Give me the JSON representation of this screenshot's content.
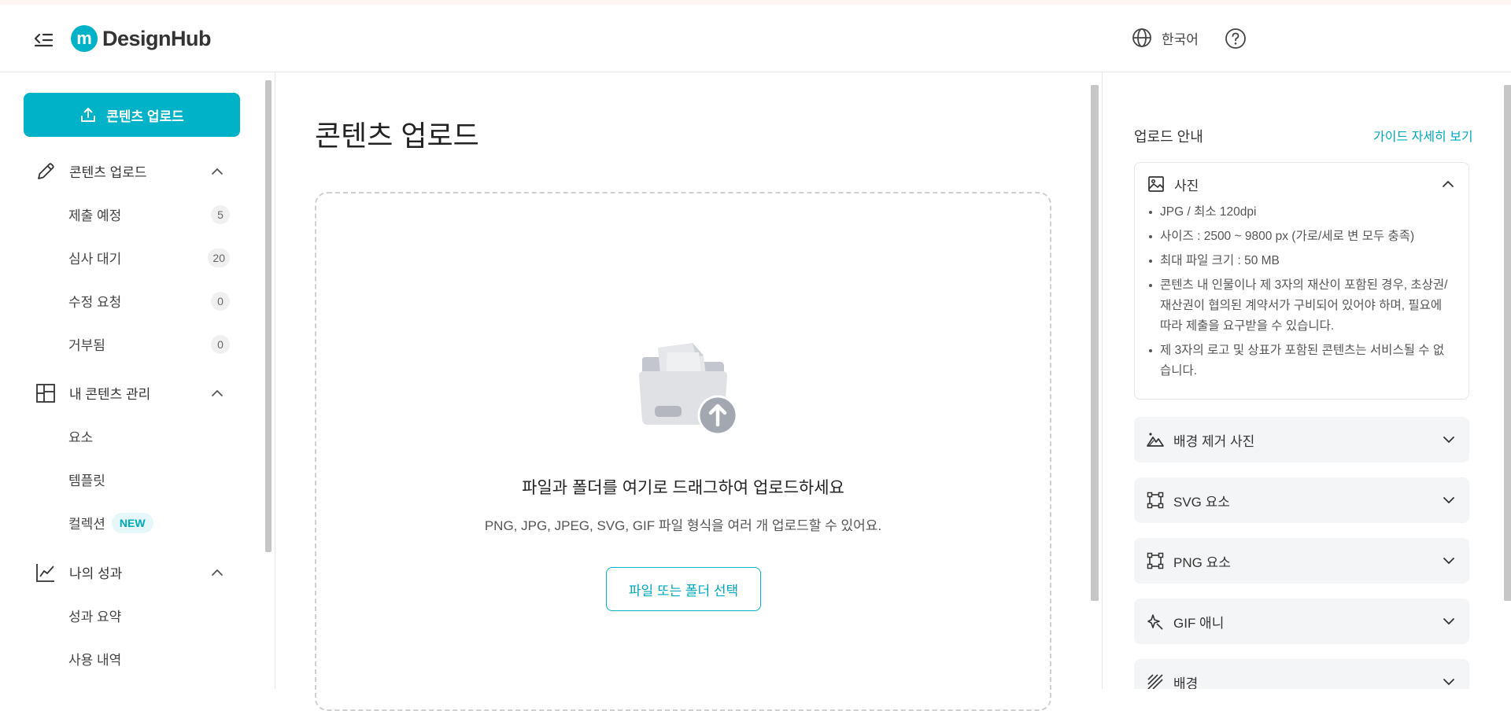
{
  "header": {
    "brand": "DesignHub",
    "language": "한국어"
  },
  "sidebar": {
    "upload_button": "콘텐츠 업로드",
    "groups": [
      {
        "label": "콘텐츠 업로드",
        "icon": "pencil-icon",
        "items": [
          {
            "label": "제출 예정",
            "count": "5"
          },
          {
            "label": "심사 대기",
            "count": "20"
          },
          {
            "label": "수정 요청",
            "count": "0"
          },
          {
            "label": "거부됨",
            "count": "0"
          }
        ]
      },
      {
        "label": "내 콘텐츠 관리",
        "icon": "layout-grid-icon",
        "items": [
          {
            "label": "요소"
          },
          {
            "label": "템플릿"
          },
          {
            "label": "컬렉션",
            "badge": "NEW"
          }
        ]
      },
      {
        "label": "나의 성과",
        "icon": "line-chart-icon",
        "items": [
          {
            "label": "성과 요약"
          },
          {
            "label": "사용 내역"
          }
        ]
      }
    ]
  },
  "main": {
    "title": "콘텐츠 업로드",
    "dropzone": {
      "title": "파일과 폴더를 여기로 드래그하여 업로드하세요",
      "subtitle": "PNG, JPG, JPEG, SVG, GIF 파일 형식을 여러 개 업로드할 수 있어요.",
      "button": "파일 또는 폴더 선택"
    }
  },
  "guide": {
    "title": "업로드 안내",
    "link": "가이드 자세히 보기",
    "sections": [
      {
        "label": "사진",
        "icon": "image-icon",
        "expanded": true,
        "bullets": [
          "JPG / 최소 120dpi",
          "사이즈 : 2500 ~ 9800 px (가로/세로 변 모두 충족)",
          "최대 파일 크기 : 50 MB",
          "콘텐츠 내 인물이나 제 3자의 재산이 포함된 경우, 초상권/재산권이 협의된 계약서가 구비되어 있어야 하며, 필요에 따라 제출을 요구받을 수 있습니다.",
          "제 3자의 로고 및 상표가 포함된 콘텐츠는 서비스될 수 없습니다."
        ]
      },
      {
        "label": "배경 제거 사진",
        "icon": "mountain-icon",
        "expanded": false
      },
      {
        "label": "SVG 요소",
        "icon": "vector-square-icon",
        "expanded": false
      },
      {
        "label": "PNG 요소",
        "icon": "vector-square-icon",
        "expanded": false
      },
      {
        "label": "GIF 애니",
        "icon": "sparkle-icon",
        "expanded": false
      },
      {
        "label": "배경",
        "icon": "hatch-pattern-icon",
        "expanded": false
      }
    ]
  },
  "colors": {
    "accent": "#00b2c8",
    "accent_text": "#00a8bd",
    "card_bg": "#f4f5f6"
  }
}
